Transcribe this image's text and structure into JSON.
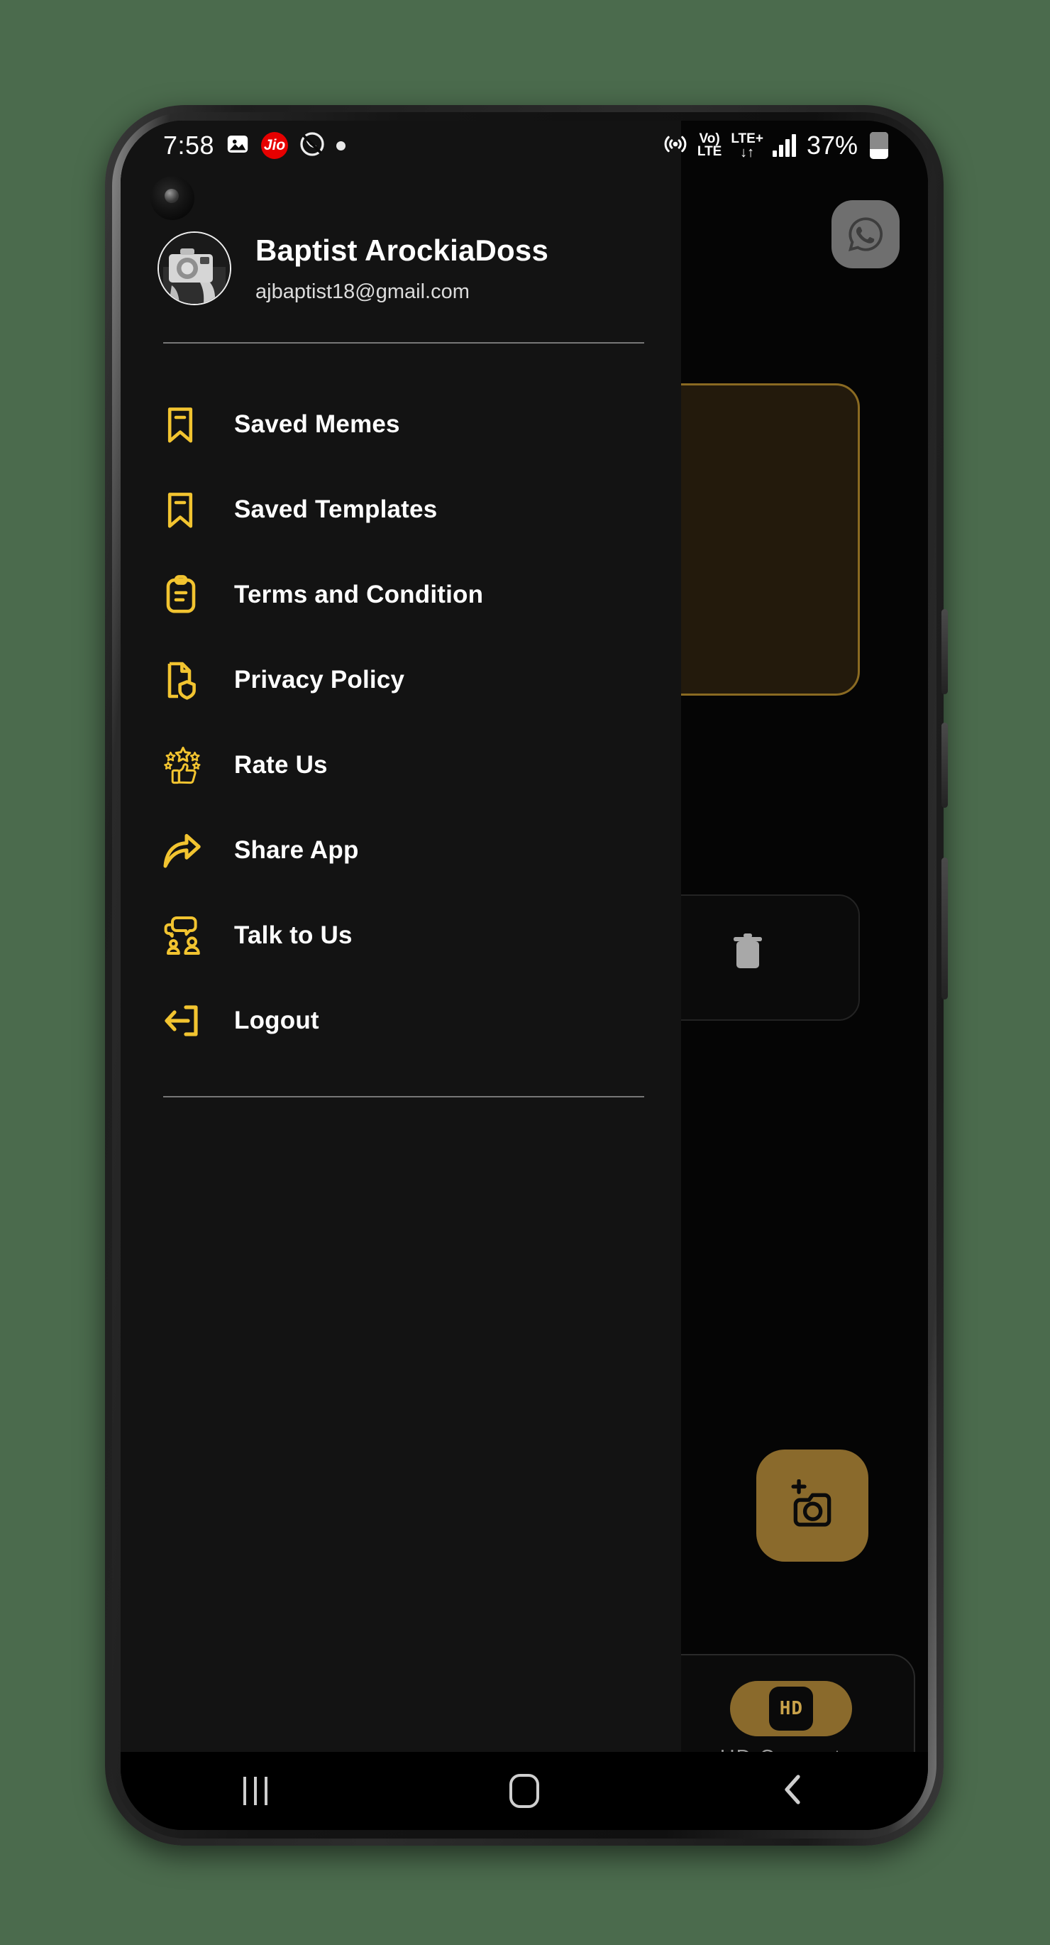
{
  "status_bar": {
    "time": "7:58",
    "left_icons": [
      "image-icon",
      "jio-icon",
      "call-icon",
      "dot-icon"
    ],
    "jio_label": "Jio",
    "hotspot_icon": "hotspot-icon",
    "volte_line1": "Vo)",
    "volte_line2": "LTE",
    "network_type": "LTE+",
    "data_arrows": "↓↑",
    "battery_percent": "37%",
    "signal_icon": "signal-bars-icon",
    "battery_icon": "battery-icon"
  },
  "drawer": {
    "profile": {
      "name": "Baptist ArockiaDoss",
      "email": "ajbaptist18@gmail.com",
      "avatar_name": "user-avatar"
    },
    "menu_items": [
      {
        "label": "Saved Memes",
        "icon": "bookmark-icon"
      },
      {
        "label": "Saved Templates",
        "icon": "bookmark-icon"
      },
      {
        "label": "Terms and Condition",
        "icon": "clipboard-icon"
      },
      {
        "label": "Privacy Policy",
        "icon": "document-shield-icon"
      },
      {
        "label": "Rate Us",
        "icon": "thumbs-up-stars-icon"
      },
      {
        "label": "Share App",
        "icon": "share-arrow-icon"
      },
      {
        "label": "Talk to Us",
        "icon": "chat-people-icon"
      },
      {
        "label": "Logout",
        "icon": "logout-arrow-icon"
      }
    ],
    "accent_color": "#F2C430",
    "background_color": "#131313"
  },
  "background_app": {
    "whatsapp_button": "whatsapp-icon",
    "card_border_color": "#8A6A22",
    "delete_button": "trash-icon",
    "add_photo_button": "add-photo-icon",
    "bottom_nav": {
      "hd_converter_label": "HD Converter",
      "hd_glyph": "HD",
      "accent_color": "#8A6A2C"
    }
  },
  "system_nav": {
    "recents": "recents-button",
    "home": "home-button",
    "back": "back-button"
  }
}
